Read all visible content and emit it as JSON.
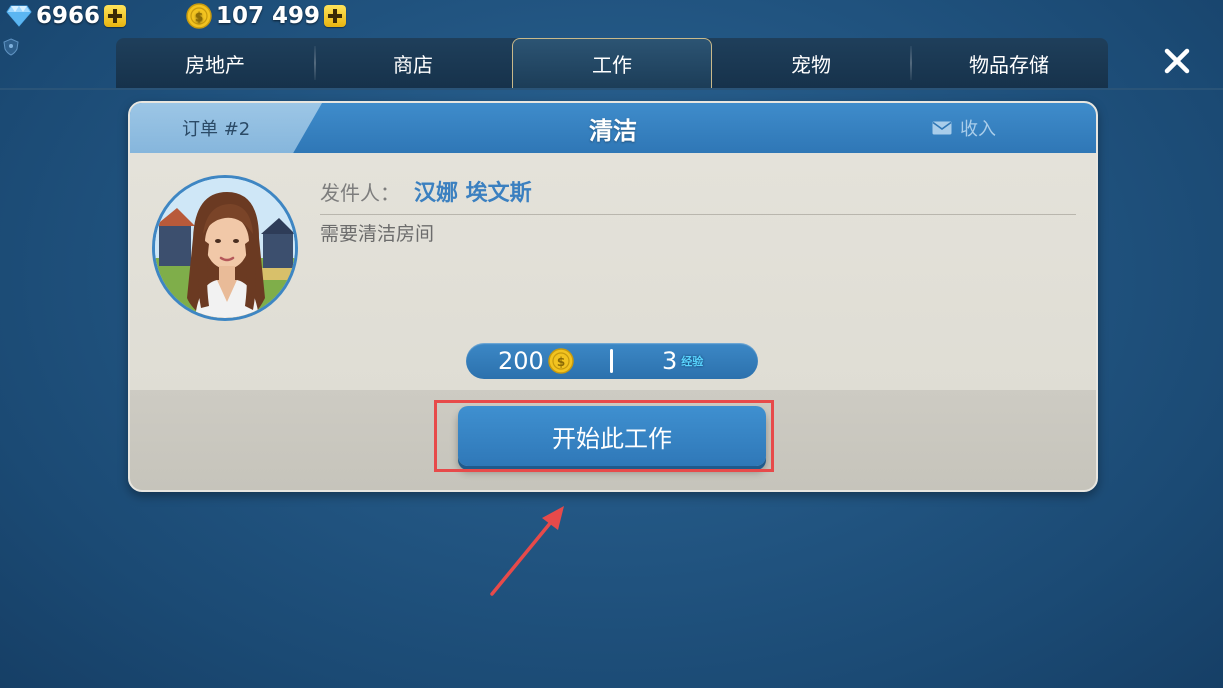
{
  "currency": {
    "gems": "6966",
    "coins": "107 499"
  },
  "tabs": [
    {
      "label": "房地产",
      "active": false
    },
    {
      "label": "商店",
      "active": false
    },
    {
      "label": "工作",
      "active": true
    },
    {
      "label": "宠物",
      "active": false
    },
    {
      "label": "物品存储",
      "active": false
    }
  ],
  "card": {
    "order_label": "订单 #2",
    "title": "清洁",
    "inbox_label": "收入",
    "sender_label": "发件人：",
    "sender_name": "汉娜 埃文斯",
    "description": "需要清洁房间",
    "reward_coins": "200",
    "reward_xp": "3",
    "xp_label": "经验",
    "start_button": "开始此工作"
  },
  "colors": {
    "background": "#235784",
    "accent_blue": "#3680c0",
    "highlight_red": "#e74a4a",
    "coin_gold": "#f2c320"
  },
  "icons": [
    "gem-icon",
    "plus-icon",
    "coin-icon",
    "shield-icon",
    "close-icon",
    "mail-icon",
    "avatar-portrait",
    "arrow-annotation"
  ]
}
